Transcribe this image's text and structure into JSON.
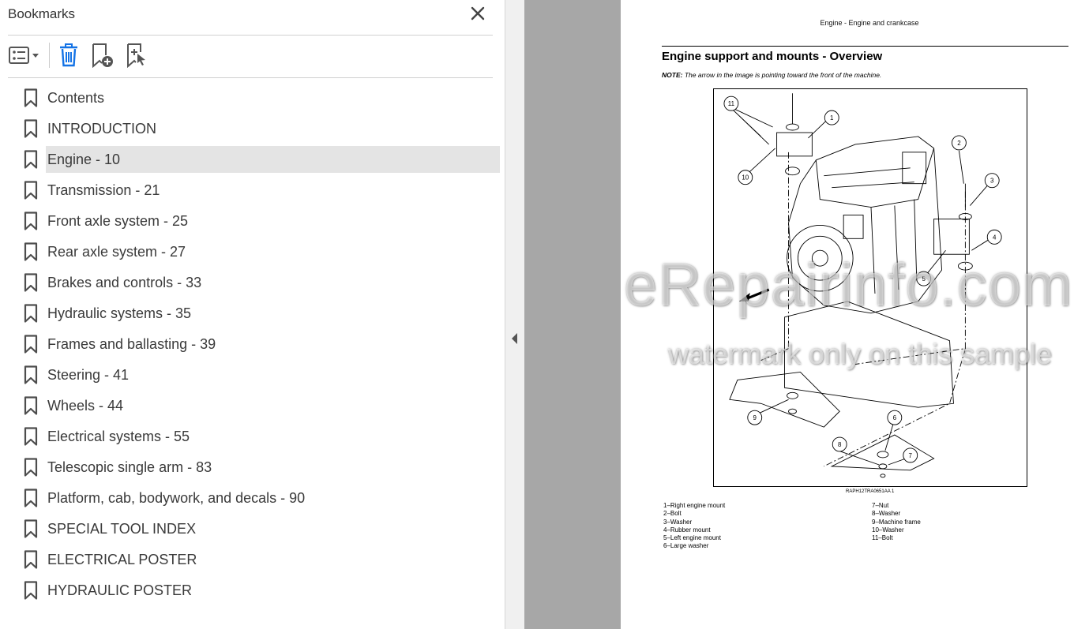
{
  "panel": {
    "title": "Bookmarks",
    "close_icon": "close-icon"
  },
  "toolbar": {
    "options_icon": "bookmark-options-icon",
    "delete_icon": "delete-bookmark-icon",
    "new_icon": "new-bookmark-icon",
    "find_icon": "find-current-bookmark-icon"
  },
  "bookmarks": [
    {
      "label": "Contents"
    },
    {
      "label": "INTRODUCTION"
    },
    {
      "label": "Engine - 10",
      "selected": true
    },
    {
      "label": "Transmission - 21"
    },
    {
      "label": "Front axle system - 25"
    },
    {
      "label": "Rear axle system - 27"
    },
    {
      "label": "Brakes and controls - 33"
    },
    {
      "label": "Hydraulic systems - 35"
    },
    {
      "label": "Frames and ballasting - 39"
    },
    {
      "label": "Steering - 41"
    },
    {
      "label": "Wheels - 44"
    },
    {
      "label": "Electrical systems - 55"
    },
    {
      "label": "Telescopic single arm - 83"
    },
    {
      "label": "Platform, cab, bodywork, and decals - 90"
    },
    {
      "label": "SPECIAL TOOL INDEX"
    },
    {
      "label": "ELECTRICAL POSTER"
    },
    {
      "label": "HYDRAULIC POSTER"
    }
  ],
  "colors": {
    "selected_bg": "#e4e4e4",
    "doc_bg": "#a7a7a7",
    "splitter": "#f0f0f0"
  },
  "document": {
    "header": "Engine - Engine and crankcase",
    "section_title": "Engine support and mounts - Overview",
    "note_label": "NOTE:",
    "note_text": "The arrow in the image is pointing toward the front of the machine.",
    "figure_caption": "RAPH12TRA0651AA    1",
    "callouts": [
      "1",
      "2",
      "3",
      "4",
      "5",
      "6",
      "7",
      "8",
      "9",
      "10",
      "11"
    ],
    "legend_left": [
      "1–Right engine mount",
      "2–Bolt",
      "3–Washer",
      "4–Rubber mount",
      "5–Left engine mount",
      "6–Large washer"
    ],
    "legend_right": [
      "7–Nut",
      "8–Washer",
      "9–Machine frame",
      "10–Washer",
      "11–Bolt"
    ]
  },
  "watermark": {
    "line1": "eRepairinfo.com",
    "line2": "watermark only on this sample"
  }
}
